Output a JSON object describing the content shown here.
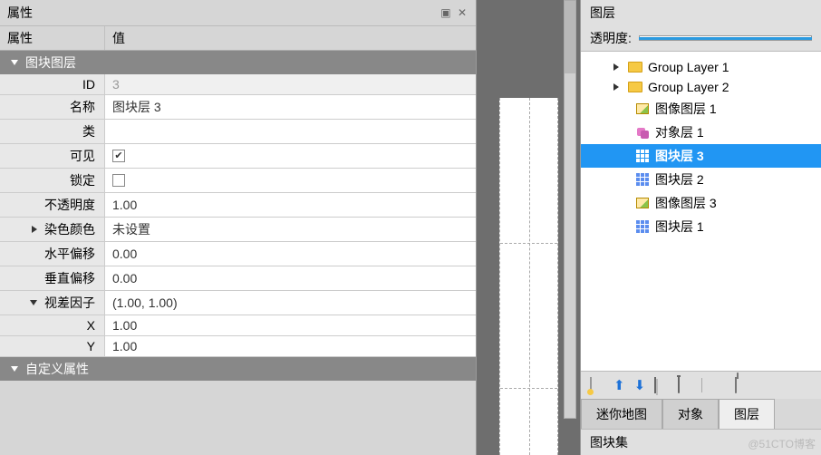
{
  "panels": {
    "properties_title": "属性",
    "header_attr": "属性",
    "header_val": "值",
    "section_tile_layer": "图块图层",
    "section_custom": "自定义属性",
    "rows": {
      "id_k": "ID",
      "id_v": "3",
      "name_k": "名称",
      "name_v": "图块层 3",
      "class_k": "类",
      "class_v": "",
      "visible_k": "可见",
      "locked_k": "锁定",
      "opacity_k": "不透明度",
      "opacity_v": "1.00",
      "tint_k": "染色颜色",
      "tint_v": "未设置",
      "offx_k": "水平偏移",
      "offx_v": "0.00",
      "offy_k": "垂直偏移",
      "offy_v": "0.00",
      "parallax_k": "视差因子",
      "parallax_v": "(1.00, 1.00)",
      "px_k": "X",
      "px_v": "1.00",
      "py_k": "Y",
      "py_v": "1.00"
    }
  },
  "layers": {
    "title": "图层",
    "opacity_label": "透明度:",
    "items": [
      {
        "label": "Group Layer 1",
        "icon": "folder",
        "indent": 1,
        "expander": "right"
      },
      {
        "label": "Group Layer 2",
        "icon": "folder",
        "indent": 1,
        "expander": "right"
      },
      {
        "label": "图像图层 1",
        "icon": "image",
        "indent": 2
      },
      {
        "label": "对象层 1",
        "icon": "object",
        "indent": 2
      },
      {
        "label": "图块层 3",
        "icon": "grid",
        "indent": 2,
        "selected": true
      },
      {
        "label": "图块层 2",
        "icon": "grid",
        "indent": 2
      },
      {
        "label": "图像图层 3",
        "icon": "image",
        "indent": 2
      },
      {
        "label": "图块层 1",
        "icon": "grid",
        "indent": 2
      }
    ],
    "tabs": {
      "mini": "迷你地图",
      "obj": "对象",
      "layer": "图层"
    },
    "tileset": "图块集"
  },
  "watermark": "@51CTO博客"
}
